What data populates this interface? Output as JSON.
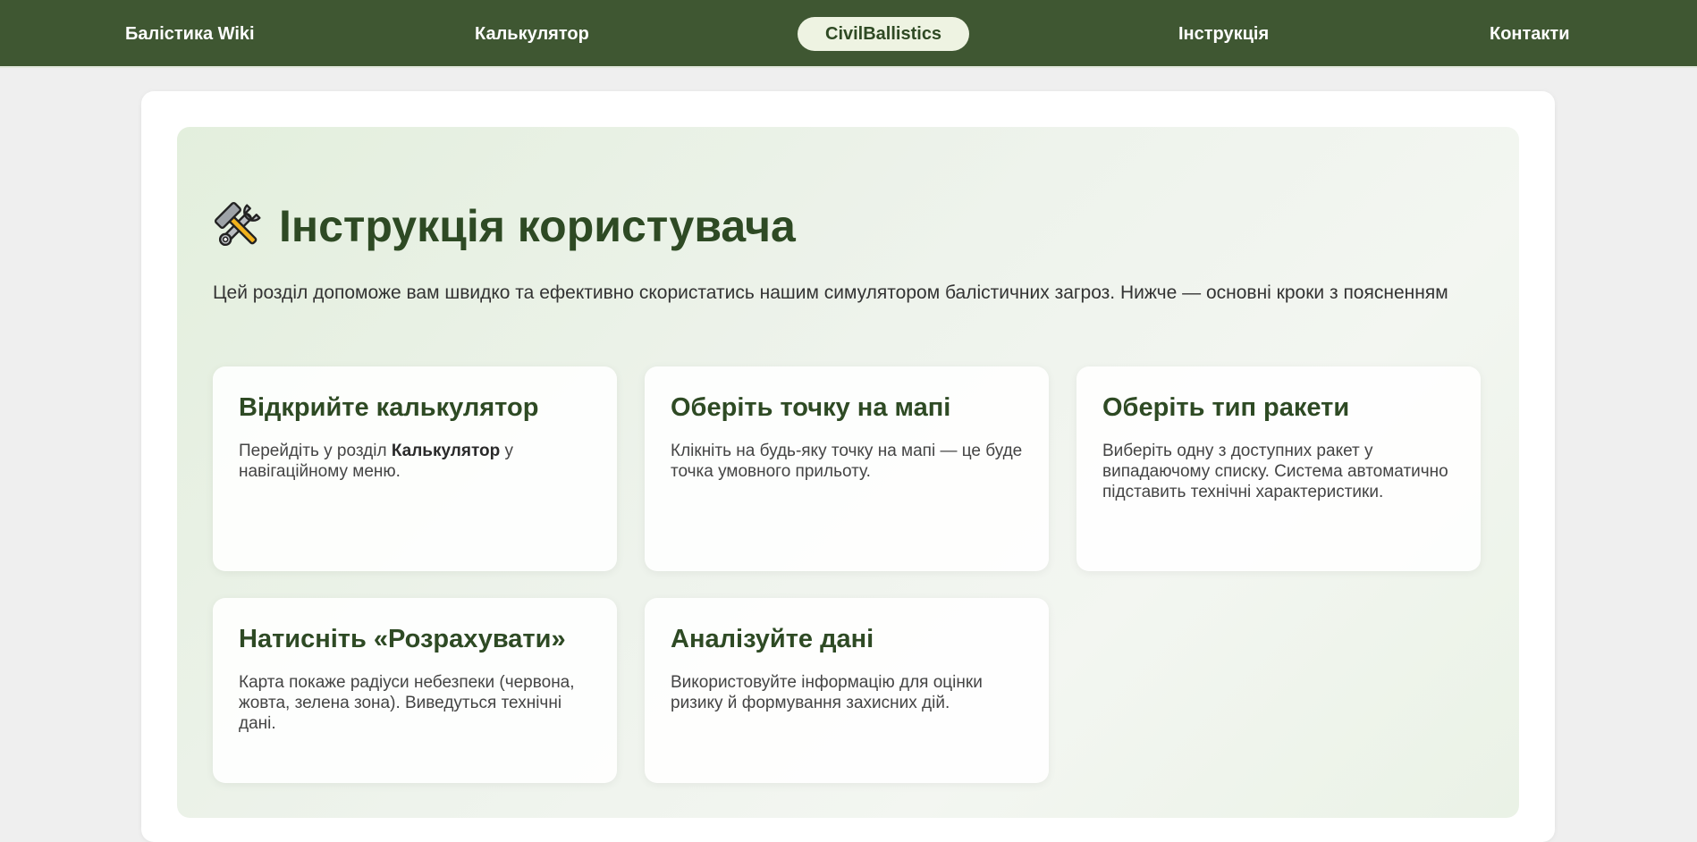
{
  "nav": {
    "items": [
      {
        "label": "Балістика Wiki",
        "active": false
      },
      {
        "label": "Калькулятор",
        "active": false
      },
      {
        "label": "CivilBallistics",
        "active": true
      },
      {
        "label": "Інструкція",
        "active": false
      },
      {
        "label": "Контакти",
        "active": false
      }
    ]
  },
  "page": {
    "title": "Інструкція користувача",
    "title_icon": "hammer-and-wrench-icon",
    "intro": "Цей розділ допоможе вам швидко та ефективно скористатись нашим симулятором балістичних загроз. Нижче — основні кроки з поясненням"
  },
  "steps": [
    {
      "title": "Відкрийте калькулятор",
      "text_before": "Перейдіть у розділ ",
      "text_bold": "Калькулятор",
      "text_after": " у навігаційному меню."
    },
    {
      "title": "Оберіть точку на мапі",
      "text": "Клікніть на будь-яку точку на мапі — це буде точка умовного прильоту."
    },
    {
      "title": "Оберіть тип ракети",
      "text": "Виберіть одну з доступних ракет у випадаючому списку. Система автоматично підставить технічні характеристики."
    },
    {
      "title": "Натисніть «Розрахувати»",
      "text": "Карта покаже радіуси небезпеки (червона, жовта, зелена зона). Виведуться технічні дані."
    },
    {
      "title": "Аналізуйте дані",
      "text": "Використовуйте інформацію для оцінки ризику й формування захисних дій."
    }
  ],
  "colors": {
    "nav_bg": "#3f5732",
    "accent_dark_green": "#2e4a24",
    "active_pill_bg": "#eef3e2",
    "page_bg": "#efefef"
  }
}
